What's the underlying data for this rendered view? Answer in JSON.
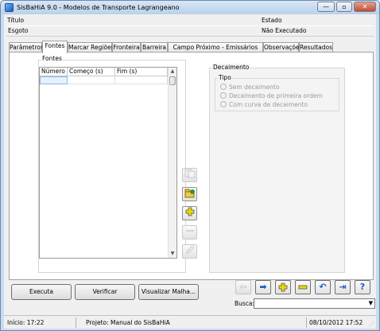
{
  "window": {
    "title": "SisBaHiA 9.0 - Modelos de Transporte Lagrangeano",
    "buttons": {
      "minimize": "—",
      "maximize": "▫",
      "close": "✕"
    }
  },
  "header": {
    "titulo_label": "Título",
    "titulo_value": "Esgoto",
    "estado_label": "Estado",
    "estado_value": "Não Executado"
  },
  "tabs": [
    {
      "label": "Parâmetros"
    },
    {
      "label": "Fontes"
    },
    {
      "label": "Marcar Regiões"
    },
    {
      "label": "Fronteira"
    },
    {
      "label": "Barreira"
    },
    {
      "label": "Campo Próximo - Emissários"
    },
    {
      "label": "Observações"
    },
    {
      "label": "Resultados"
    }
  ],
  "fontes": {
    "group_label": "Fontes",
    "columns": [
      "Número",
      "Começo (s)",
      "Fim (s)"
    ]
  },
  "decaimento": {
    "group_label": "Decaimento",
    "tipo_label": "Tipo",
    "options": [
      "Sem decaimento",
      "Decaimento de primeira ordem",
      "Com curva de decaimento"
    ]
  },
  "actions": {
    "executa": "Executa",
    "verificar": "Verificar",
    "visualizar": "Visualizar Malha..."
  },
  "search": {
    "label": "Busca:",
    "value": ""
  },
  "status": {
    "inicio": "Início: 17:22",
    "projeto": "Projeto: Manual do SisBaHiA",
    "datetime": "08/10/2012 17:52"
  },
  "colors": {
    "accent": "#1f5fbf",
    "add": "#e3d400",
    "remove": "#e3d400"
  }
}
